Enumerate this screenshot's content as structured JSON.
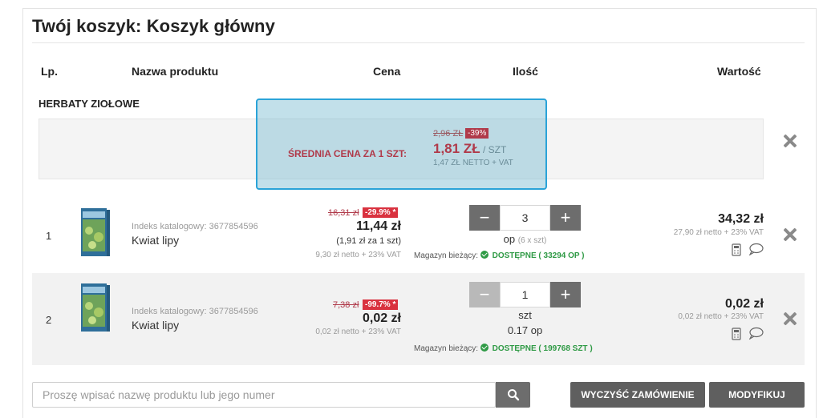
{
  "cart": {
    "title": "Twój koszyk: Koszyk główny",
    "headers": {
      "lp": "Lp.",
      "name": "Nazwa produktu",
      "price": "Cena",
      "qty": "Ilość",
      "value": "Wartość"
    },
    "category": "HERBATY ZIOŁOWE",
    "average": {
      "label": "ŚREDNIA CENA ZA 1 SZT:",
      "old_price": "2,96 ZŁ",
      "discount": "-39%",
      "price": "1,81 ZŁ",
      "unit": "/ SZT",
      "netto": "1,47 ZŁ NETTO + VAT"
    },
    "items": [
      {
        "lp": "1",
        "index": "Indeks katalogowy: 3677854596",
        "name": "Kwiat lipy",
        "old_price": "16,31 zł",
        "discount": "-29.9% *",
        "price": "11,44 zł",
        "price_per_unit": "(1,91 zł  za 1 szt)",
        "price_netto": "9,30 zł netto + 23% VAT",
        "qty": "3",
        "unit": "op",
        "unit_extra": "(6 x szt)",
        "stock_label": "Magazyn bieżący:",
        "stock_status": "DOSTĘPNE ( 33294 OP )",
        "value": "34,32 zł",
        "value_netto": "27,90 zł netto + 23% VAT"
      },
      {
        "lp": "2",
        "index": "Indeks katalogowy: 3677854596",
        "name": "Kwiat lipy",
        "old_price": "7,38 zł",
        "discount": "-99.7% *",
        "price": "0,02 zł",
        "price_netto": "0,02 zł netto + 23% VAT",
        "qty": "1",
        "unit": "szt",
        "unit_extra": "0.17 op",
        "stock_label": "Magazyn bieżący:",
        "stock_status": "DOSTĘPNE ( 199768 SZT )",
        "value": "0,02 zł",
        "value_netto": "0,02 zł netto + 23% VAT"
      }
    ],
    "stepper": {
      "minus": "−",
      "plus": "+"
    },
    "search": {
      "placeholder": "Proszę wpisać nazwę produktu lub jego numer",
      "value": ""
    },
    "buttons": {
      "clear": "WYCZYŚĆ ZAMÓWIENIE",
      "modify": "MODYFIKUJ"
    },
    "icons": [
      "close-icon",
      "calculator-icon",
      "comment-icon",
      "search-icon",
      "check-icon"
    ],
    "colors": {
      "accent": "#b03a4a",
      "badge": "#d9323f",
      "available": "#2f9a45",
      "button": "#5f5f5f",
      "overlay_border": "#2aa3d8"
    }
  }
}
